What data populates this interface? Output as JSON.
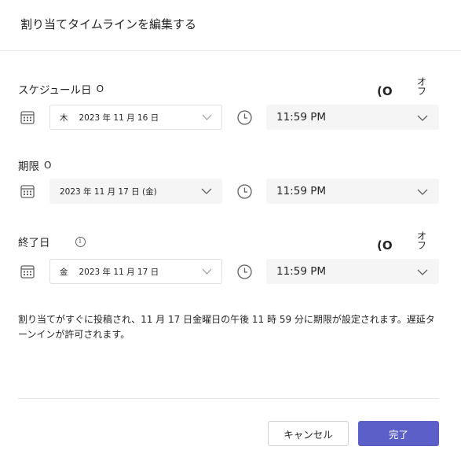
{
  "dialog": {
    "title": "割り当てタイムラインを編集する"
  },
  "schedule": {
    "label": "スケジュール日",
    "marker": "O",
    "toggle_circle": "(O",
    "toggle_label": "オフ",
    "date": {
      "weekday": "木",
      "value": "2023 年 11 月 16 日"
    },
    "time": "11:59 PM"
  },
  "due": {
    "label": "期限",
    "marker": "O",
    "date": {
      "value": "2023 年 11 月 17 日 (金)"
    },
    "time": "11:59 PM"
  },
  "close": {
    "label": "終了日",
    "info": "i",
    "toggle_circle": "(O",
    "toggle_label": "オフ",
    "date": {
      "weekday": "金",
      "value": "2023 年 11 月 17 日"
    },
    "time": "11:59 PM"
  },
  "message": "割り当てがすぐに投稿され、11 月 17 日金曜日の午後 11 時 59 分に期限が設定されます。遅延ターンインが許可されます。",
  "buttons": {
    "cancel": "キャンセル",
    "done": "完了"
  },
  "colors": {
    "primary": "#5b5fc7",
    "field_bg": "#f5f5f5"
  },
  "icons": [
    "calendar-icon",
    "clock-icon",
    "chevron-down-icon",
    "info-icon"
  ]
}
